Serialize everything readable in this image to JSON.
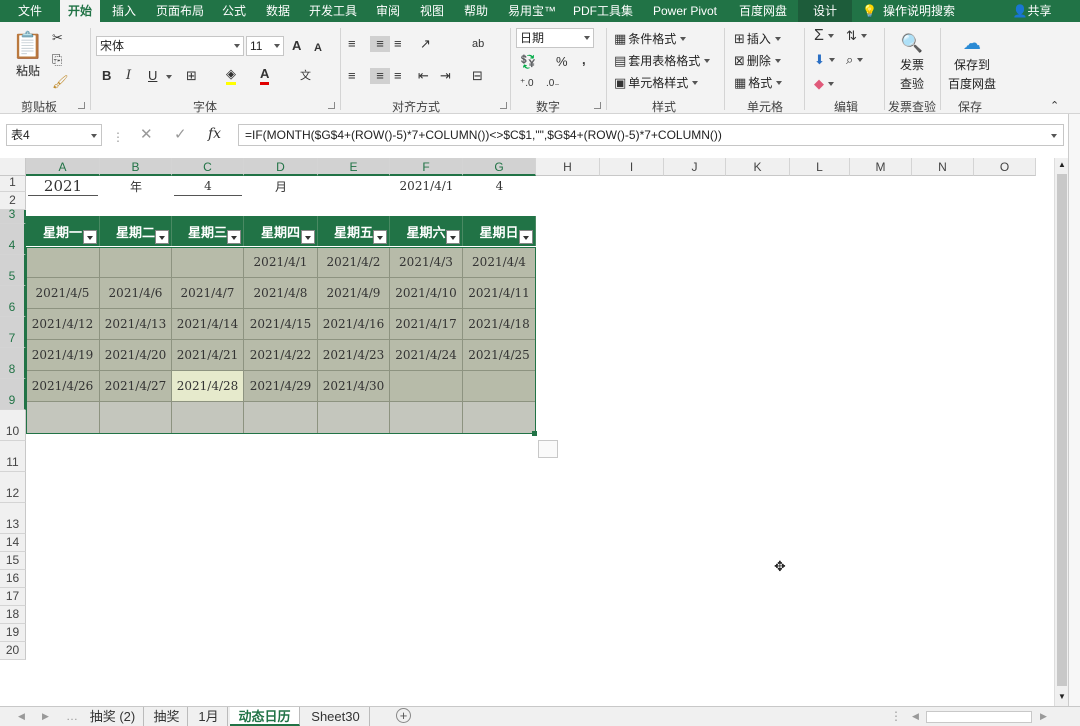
{
  "menu": {
    "tabs": [
      "文件",
      "开始",
      "插入",
      "页面布局",
      "公式",
      "数据",
      "开发工具",
      "审阅",
      "视图",
      "帮助",
      "易用宝™",
      "PDF工具集",
      "Power Pivot",
      "百度网盘",
      "设计"
    ],
    "active": "开始",
    "tell_me": "操作说明搜索",
    "share": "共享"
  },
  "ribbon": {
    "clipboard": {
      "paste": "粘贴",
      "label": "剪贴板"
    },
    "font": {
      "name": "宋体",
      "size": "11",
      "label": "字体",
      "bold": "B",
      "italic": "I",
      "underline": "U",
      "grow": "A",
      "shrink": "A",
      "color_letter": "A",
      "phonetic": "文"
    },
    "align": {
      "label": "对齐方式",
      "wrap": "ab"
    },
    "number": {
      "format": "日期",
      "label": "数字",
      "percent": "%",
      "comma": ","
    },
    "styles": {
      "cond": "条件格式",
      "table": "套用表格格式",
      "cell": "单元格样式",
      "label": "样式"
    },
    "cells": {
      "insert": "插入",
      "delete": "删除",
      "format": "格式",
      "label": "单元格"
    },
    "edit": {
      "label": "编辑",
      "sum": "Σ"
    },
    "invoice": {
      "btn": "发票",
      "btn2": "查验",
      "label": "发票查验"
    },
    "save": {
      "btn": "保存到",
      "btn2": "百度网盘",
      "label": "保存"
    }
  },
  "formula_bar": {
    "name_box": "表4",
    "fx": "fx",
    "formula": "=IF(MONTH($G$4+(ROW()-5)*7+COLUMN())<>$C$1,\"\",$G$4+(ROW()-5)*7+COLUMN())"
  },
  "grid": {
    "columns": [
      "A",
      "B",
      "C",
      "D",
      "E",
      "F",
      "G",
      "H",
      "I",
      "J",
      "K",
      "L",
      "M",
      "N",
      "O"
    ],
    "rows": [
      "1",
      "2",
      "3",
      "4",
      "5",
      "6",
      "7",
      "8",
      "9",
      "10",
      "11",
      "12",
      "13",
      "14",
      "15",
      "16",
      "17",
      "18",
      "19",
      "20"
    ],
    "row1": {
      "A": "2021",
      "B": "年",
      "C": "4",
      "D": "月",
      "F": "2021/4/1",
      "G": "4"
    },
    "weekdays": [
      "星期一",
      "星期二",
      "星期三",
      "星期四",
      "星期五",
      "星期六",
      "星期日"
    ],
    "calendar": [
      [
        "",
        "",
        "",
        "2021/4/1",
        "2021/4/2",
        "2021/4/3",
        "2021/4/4"
      ],
      [
        "2021/4/5",
        "2021/4/6",
        "2021/4/7",
        "2021/4/8",
        "2021/4/9",
        "2021/4/10",
        "2021/4/11"
      ],
      [
        "2021/4/12",
        "2021/4/13",
        "2021/4/14",
        "2021/4/15",
        "2021/4/16",
        "2021/4/17",
        "2021/4/18"
      ],
      [
        "2021/4/19",
        "2021/4/20",
        "2021/4/21",
        "2021/4/22",
        "2021/4/23",
        "2021/4/24",
        "2021/4/25"
      ],
      [
        "2021/4/26",
        "2021/4/27",
        "2021/4/28",
        "2021/4/29",
        "2021/4/30",
        "",
        ""
      ],
      [
        "",
        "",
        "",
        "",
        "",
        "",
        ""
      ]
    ]
  },
  "sheets": {
    "tabs": [
      "抽奖 (2)",
      "抽奖",
      "1月",
      "动态日历",
      "Sheet30"
    ],
    "active": "动态日历",
    "add": "+"
  },
  "colors": {
    "accent": "#217346",
    "table_body": "#b7bba9",
    "highlight": "#e6eacc"
  }
}
